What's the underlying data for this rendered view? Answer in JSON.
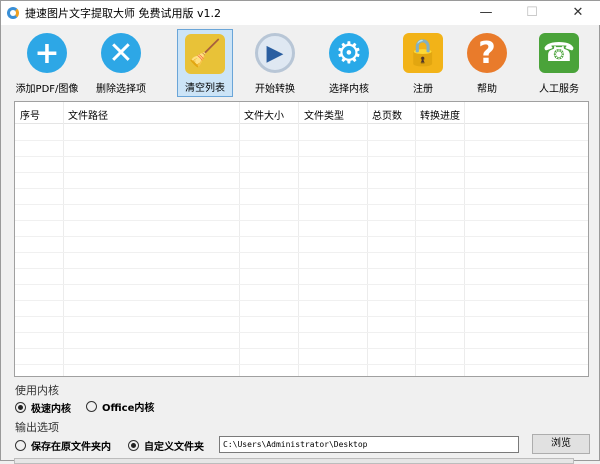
{
  "window": {
    "title": "捷速图片文字提取大师 免费试用版 v1.2",
    "minimize": "—",
    "maximize": "☐",
    "close": "✕"
  },
  "toolbar": [
    {
      "label": "添加PDF/图像",
      "icon": "add-icon",
      "glyph": "+",
      "color": "#2da7e6"
    },
    {
      "label": "删除选择项",
      "icon": "delete-icon",
      "glyph": "✕",
      "color": "#2da7e6"
    },
    {
      "label": "清空列表",
      "icon": "broom-icon",
      "glyph": "🧹",
      "color": "#e8c238"
    },
    {
      "label": "开始转换",
      "icon": "play-icon",
      "glyph": "▶",
      "color": "#dfe8f2"
    },
    {
      "label": "选择内核",
      "icon": "gear-icon",
      "glyph": "⚙",
      "color": "#29a9e8"
    },
    {
      "label": "注册",
      "icon": "lock-icon",
      "glyph": "🔒",
      "color": "#f2b318"
    },
    {
      "label": "帮助",
      "icon": "help-book-icon",
      "glyph": "?",
      "color": "#e97b2b"
    },
    {
      "label": "人工服务",
      "icon": "phone-icon",
      "glyph": "☎",
      "color": "#4aa33a"
    }
  ],
  "table": {
    "columns": [
      "序号",
      "文件路径",
      "文件大小",
      "文件类型",
      "总页数",
      "转换进度"
    ],
    "rows": []
  },
  "engine": {
    "label": "使用内核",
    "options": [
      "极速内核",
      "Office内核"
    ],
    "selected": "极速内核"
  },
  "output": {
    "label": "输出选项",
    "options": [
      "保存在原文件夹内",
      "自定义文件夹"
    ],
    "selected": "自定义文件夹",
    "path": "C:\\Users\\Administrator\\Desktop",
    "browse": "浏览"
  }
}
